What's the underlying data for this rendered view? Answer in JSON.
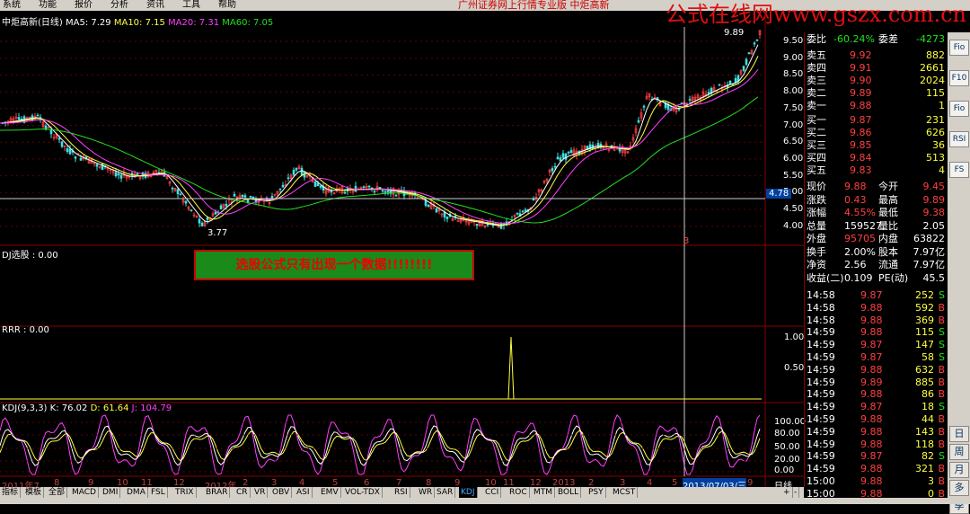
{
  "menu": [
    "系统",
    "功能",
    "报价",
    "分析",
    "资讯",
    "工具",
    "帮助"
  ],
  "app_title": "广州证券网上行情专业版  中炬高新",
  "watermark": "公式在线网www.gszx.com.cn",
  "main_pane": {
    "title": "中炬高新(日线)",
    "ma5": "MA5: 7.29",
    "ma10": "MA10: 7.15",
    "ma20": "MA20: 7.31",
    "ma60": "MA60: 7.05",
    "price_labels": [
      "9.50",
      "9.00",
      "8.50",
      "8.00",
      "7.50",
      "7.00",
      "6.50",
      "6.00",
      "5.50",
      "5.00",
      "4.50",
      "4.00"
    ],
    "high_label": "9.89",
    "low_label": "3.77",
    "cursor_price": "4.78",
    "marker": "3"
  },
  "xuangu_pane": {
    "title": "DJ选股 : 0.00",
    "message": "选股公式只有出现一个数据!!!!!!!!"
  },
  "rrr_pane": {
    "title": "RRR : 0.00",
    "ticks": [
      "1.00",
      "0.50"
    ]
  },
  "kdj_pane": {
    "title": "KDJ(9,3,3)",
    "k": "K: 76.02",
    "d": "D: 61.64",
    "j": "J: 104.79",
    "ticks": [
      "100.00",
      "80.00",
      "50.00",
      "20.00",
      "0.00"
    ]
  },
  "x_axis": {
    "labels": [
      "2011年7",
      "8",
      "9",
      "10",
      "11",
      "12",
      "2012年",
      "2",
      "3",
      "4",
      "5",
      "6",
      "7",
      "8",
      "9",
      "10",
      "11",
      "12",
      "2013",
      "2",
      "3",
      "4",
      "5",
      "6",
      "2013/07/03/三",
      "9"
    ],
    "period": "日线"
  },
  "quote": {
    "weibi": {
      "label": "委比",
      "value": "-60.24%",
      "label2": "委差",
      "value2": "-4273"
    },
    "sells": [
      {
        "label": "卖五",
        "price": "9.92",
        "vol": "882"
      },
      {
        "label": "卖四",
        "price": "9.91",
        "vol": "2661"
      },
      {
        "label": "卖三",
        "price": "9.90",
        "vol": "2024"
      },
      {
        "label": "卖二",
        "price": "9.89",
        "vol": "115"
      },
      {
        "label": "卖一",
        "price": "9.88",
        "vol": "1"
      }
    ],
    "buys": [
      {
        "label": "买一",
        "price": "9.87",
        "vol": "231"
      },
      {
        "label": "买二",
        "price": "9.86",
        "vol": "626"
      },
      {
        "label": "买三",
        "price": "9.85",
        "vol": "36"
      },
      {
        "label": "买四",
        "price": "9.84",
        "vol": "513"
      },
      {
        "label": "买五",
        "price": "9.83",
        "vol": "4"
      }
    ],
    "stats": [
      {
        "l1": "现价",
        "v1": "9.88",
        "l2": "今开",
        "v2": "9.45"
      },
      {
        "l1": "涨跌",
        "v1": "0.43",
        "l2": "最高",
        "v2": "9.89"
      },
      {
        "l1": "涨幅",
        "v1": "4.55%",
        "l2": "最低",
        "v2": "9.38"
      },
      {
        "l1": "总量",
        "v1": "159527",
        "l2": "量比",
        "v2": "2.05"
      },
      {
        "l1": "外盘",
        "v1": "95705",
        "l2": "内盘",
        "v2": "63822"
      },
      {
        "l1": "换手",
        "v1": "2.00%",
        "l2": "股本",
        "v2": "7.97亿"
      },
      {
        "l1": "净资",
        "v1": "2.56",
        "l2": "流通",
        "v2": "7.97亿"
      },
      {
        "l1": "收益(二)",
        "v1": "0.109",
        "l2": "PE(动)",
        "v2": "45.5"
      }
    ],
    "ticks": [
      {
        "t": "14:58",
        "p": "9.87",
        "v": "252",
        "s": "S"
      },
      {
        "t": "14:58",
        "p": "9.88",
        "v": "592",
        "s": "B"
      },
      {
        "t": "14:58",
        "p": "9.88",
        "v": "369",
        "s": "B"
      },
      {
        "t": "14:59",
        "p": "9.88",
        "v": "115",
        "s": "S"
      },
      {
        "t": "14:59",
        "p": "9.87",
        "v": "147",
        "s": "S"
      },
      {
        "t": "14:59",
        "p": "9.87",
        "v": "58",
        "s": "S"
      },
      {
        "t": "14:59",
        "p": "9.88",
        "v": "632",
        "s": "B"
      },
      {
        "t": "14:59",
        "p": "9.89",
        "v": "885",
        "s": "B"
      },
      {
        "t": "14:59",
        "p": "9.88",
        "v": "86",
        "s": "B"
      },
      {
        "t": "14:59",
        "p": "9.87",
        "v": "18",
        "s": "S"
      },
      {
        "t": "14:59",
        "p": "9.88",
        "v": "44",
        "s": "B"
      },
      {
        "t": "14:59",
        "p": "9.88",
        "v": "143",
        "s": "B"
      },
      {
        "t": "14:59",
        "p": "9.88",
        "v": "118",
        "s": "B"
      },
      {
        "t": "14:59",
        "p": "9.87",
        "v": "82",
        "s": "S"
      },
      {
        "t": "14:59",
        "p": "9.88",
        "v": "321",
        "s": "B"
      },
      {
        "t": "15:00",
        "p": "9.88",
        "v": "3",
        "s": "B"
      },
      {
        "t": "15:00",
        "p": "9.88",
        "v": "0",
        "s": "B"
      }
    ]
  },
  "toolbar": [
    "Fio",
    "F10",
    "Fio",
    "RSI",
    "FS",
    "日",
    "周",
    "月",
    "多",
    "季"
  ],
  "bottom_tabs": [
    "指标",
    "模板",
    "全部",
    "MACD",
    "DMI",
    "DMA",
    "FSL",
    "TRIX",
    "BRAR",
    "CR",
    "VR",
    "OBV",
    "ASI",
    "EMV",
    "VOL-TDX",
    "RSI",
    "WR",
    "SAR",
    "KDJ",
    "CCI",
    "ROC",
    "MTM",
    "BOLL",
    "PSY",
    "MCST"
  ],
  "active_tab": "KDJ",
  "bottom_right": [
    "日线",
    "+",
    "-"
  ],
  "colors": {
    "up": "#ff4040",
    "down": "#40e0e0",
    "ma5": "#ffffff",
    "ma10": "#ffff40",
    "ma20": "#ff40ff",
    "ma60": "#20e020",
    "accent": "#e01010"
  }
}
